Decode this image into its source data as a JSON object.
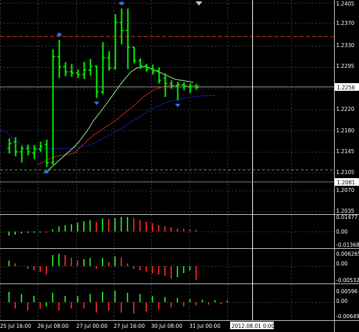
{
  "colors": {
    "background": "#000000",
    "grid": "#3c3c3c",
    "bar": "#00ff00",
    "axis_text": "#ffffff",
    "ma_fast": "#98ff98",
    "ma_mid": "#cc2020",
    "ma_slow": "#1a1aa8",
    "fractal": "#3a6cff",
    "hline_red": "#cc3a1a",
    "hline_green": "#3ec83e",
    "hist_up": "#22cc22",
    "hist_down": "#dd2222",
    "price_box_bg": "#ffffff",
    "price_box_text": "#000000"
  },
  "price_axis": {
    "labels": [
      "1.2405",
      "1.2370",
      "1.2330",
      "1.2295",
      "1.2220",
      "1.2180",
      "1.2145",
      "1.2105",
      "1.2070",
      "1.2035"
    ],
    "current_price": "1.2256",
    "crosshair_price": "1.2081"
  },
  "time_axis": {
    "labels": [
      "25 Jul 16:00",
      "26 Jul 08:00",
      "27 Jul 00:00",
      "27 Jul 16:00",
      "30 Jul 08:00",
      "31 Jul 00:00"
    ],
    "crosshair_time": "2012.08.01 0:00"
  },
  "indicators": [
    {
      "id": "osc1",
      "top_label": "0.01477",
      "zero_label": "0.00",
      "bottom_label": "-0.01368"
    },
    {
      "id": "osc2",
      "top_label": "0.006265",
      "zero_label": "0.00",
      "bottom_label": "-0.00532"
    },
    {
      "id": "osc3",
      "top_label": "0.00596",
      "zero_label": "0.00",
      "bottom_label": "-0.00649"
    }
  ],
  "chart_data": {
    "type": "ohlc",
    "instrument_note": "",
    "bars": [
      {
        "o": 1.2146,
        "h": 1.2164,
        "l": 1.2137,
        "c": 1.2155
      },
      {
        "o": 1.2158,
        "h": 1.2166,
        "l": 1.2132,
        "c": 1.214
      },
      {
        "o": 1.214,
        "h": 1.2151,
        "l": 1.2121,
        "c": 1.2146
      },
      {
        "o": 1.2146,
        "h": 1.2153,
        "l": 1.2134,
        "c": 1.214
      },
      {
        "o": 1.2138,
        "h": 1.2152,
        "l": 1.2127,
        "c": 1.2145
      },
      {
        "o": 1.2145,
        "h": 1.2158,
        "l": 1.214,
        "c": 1.215
      },
      {
        "o": 1.2153,
        "h": 1.2162,
        "l": 1.2113,
        "c": 1.2121
      },
      {
        "o": 1.2121,
        "h": 1.2323,
        "l": 1.2117,
        "c": 1.231
      },
      {
        "o": 1.231,
        "h": 1.234,
        "l": 1.2272,
        "c": 1.2292
      },
      {
        "o": 1.2292,
        "h": 1.23,
        "l": 1.2275,
        "c": 1.2283
      },
      {
        "o": 1.2283,
        "h": 1.2297,
        "l": 1.2274,
        "c": 1.2281
      },
      {
        "o": 1.2281,
        "h": 1.2287,
        "l": 1.2272,
        "c": 1.2278
      },
      {
        "o": 1.2278,
        "h": 1.2301,
        "l": 1.227,
        "c": 1.2286
      },
      {
        "o": 1.2286,
        "h": 1.2306,
        "l": 1.2276,
        "c": 1.2293
      },
      {
        "o": 1.2293,
        "h": 1.2294,
        "l": 1.2236,
        "c": 1.2247
      },
      {
        "o": 1.2247,
        "h": 1.2336,
        "l": 1.2243,
        "c": 1.2308
      },
      {
        "o": 1.2308,
        "h": 1.232,
        "l": 1.2285,
        "c": 1.229
      },
      {
        "o": 1.229,
        "h": 1.2386,
        "l": 1.2287,
        "c": 1.2371
      },
      {
        "o": 1.2371,
        "h": 1.2396,
        "l": 1.2332,
        "c": 1.2357
      },
      {
        "o": 1.2357,
        "h": 1.2396,
        "l": 1.2288,
        "c": 1.2327
      },
      {
        "o": 1.2327,
        "h": 1.2327,
        "l": 1.2298,
        "c": 1.2303
      },
      {
        "o": 1.2303,
        "h": 1.2307,
        "l": 1.2288,
        "c": 1.2294
      },
      {
        "o": 1.2294,
        "h": 1.2297,
        "l": 1.2283,
        "c": 1.2288
      },
      {
        "o": 1.2288,
        "h": 1.2296,
        "l": 1.2278,
        "c": 1.2283
      },
      {
        "o": 1.2285,
        "h": 1.2291,
        "l": 1.2262,
        "c": 1.2268
      },
      {
        "o": 1.2272,
        "h": 1.228,
        "l": 1.2238,
        "c": 1.2262
      },
      {
        "o": 1.2262,
        "h": 1.2268,
        "l": 1.2253,
        "c": 1.2258
      },
      {
        "o": 1.2258,
        "h": 1.2265,
        "l": 1.2232,
        "c": 1.226
      },
      {
        "o": 1.226,
        "h": 1.2264,
        "l": 1.225,
        "c": 1.2258
      },
      {
        "o": 1.2256,
        "h": 1.2262,
        "l": 1.2245,
        "c": 1.2256
      },
      {
        "o": 1.2256,
        "h": 1.2261,
        "l": 1.2251,
        "c": 1.2255
      }
    ],
    "fractals_up": [
      8,
      18
    ],
    "fractals_down": [
      6,
      14,
      27
    ],
    "ma_fast": [
      null,
      null,
      null,
      null,
      null,
      null,
      null,
      1.2102,
      1.211,
      1.212,
      1.213,
      1.214,
      1.215,
      1.2163,
      1.2178,
      1.2196,
      1.221,
      1.2225,
      1.224,
      1.2256,
      1.227,
      1.2283,
      1.229,
      1.2292,
      1.229,
      1.2285,
      1.228,
      1.2275,
      1.227,
      1.2268,
      1.2266,
      1.2264
    ],
    "ma_mid": [
      null,
      null,
      null,
      null,
      null,
      null,
      1.2117,
      1.2122,
      1.2128,
      1.2132,
      1.2134,
      1.2136,
      1.2138,
      1.215,
      1.216,
      1.217,
      1.2177,
      1.2185,
      1.2192,
      1.22,
      1.221,
      1.2218,
      1.2228,
      1.2238,
      1.2246,
      1.2252,
      1.2256,
      1.2258,
      1.2259,
      1.2259,
      1.2258,
      1.2258,
      1.2258
    ],
    "ma_slow": [
      1.2182,
      1.2178,
      1.217,
      1.216,
      1.2153,
      1.2148,
      1.2146,
      1.2146,
      1.2146,
      1.2146,
      1.2146,
      1.2146,
      1.2147,
      1.2148,
      1.215,
      1.2153,
      1.2158,
      1.2164,
      1.217,
      1.2176,
      1.2183,
      1.219,
      1.2197,
      1.2204,
      1.2211,
      1.2218,
      1.2223,
      1.2228,
      1.2231,
      1.2234,
      1.2236,
      1.2238,
      1.2239,
      1.224,
      1.2241,
      1.2241
    ],
    "hline_red": 1.2346,
    "hline_green": 1.2108,
    "current_price": 1.2256,
    "price_range": [
      1.2035,
      1.2405
    ],
    "hist1": [
      -0.004,
      -0.003,
      -0.002,
      -0.0015,
      -0.0012,
      -0.001,
      -0.0012,
      0.002,
      0.005,
      0.006,
      0.007,
      0.0085,
      0.01,
      0.011,
      0.009,
      0.0125,
      0.012,
      0.013,
      0.014,
      0.014,
      0.013,
      0.011,
      0.0095,
      0.008,
      0.006,
      0.005,
      0.004,
      0.003,
      0.0025,
      0.002,
      0.0015
    ],
    "hist2": [
      0.002,
      0.001,
      0.0,
      -0.001,
      -0.0015,
      -0.002,
      -0.003,
      0.004,
      0.0045,
      0.004,
      0.003,
      0.002,
      0.0025,
      0.003,
      -0.001,
      0.003,
      0.0015,
      0.0035,
      0.003,
      0.001,
      -0.001,
      -0.0015,
      -0.002,
      -0.0025,
      -0.003,
      -0.0035,
      -0.0045,
      -0.004,
      -0.0025,
      -0.0015,
      -0.005
    ],
    "hist3": [
      0.005,
      -0.003,
      0.004,
      -0.004,
      0.003,
      -0.003,
      -0.002,
      0.0045,
      -0.004,
      0.003,
      -0.003,
      0.003,
      -0.003,
      0.004,
      -0.005,
      0.005,
      -0.004,
      0.0055,
      -0.005,
      0.0045,
      -0.0055,
      0.004,
      -0.0045,
      0.003,
      -0.0035,
      0.0025,
      -0.0025,
      0.002,
      -0.002,
      0.0015,
      -0.0015,
      0.0012,
      -0.0012,
      0.001,
      -0.001,
      0.0008
    ]
  }
}
